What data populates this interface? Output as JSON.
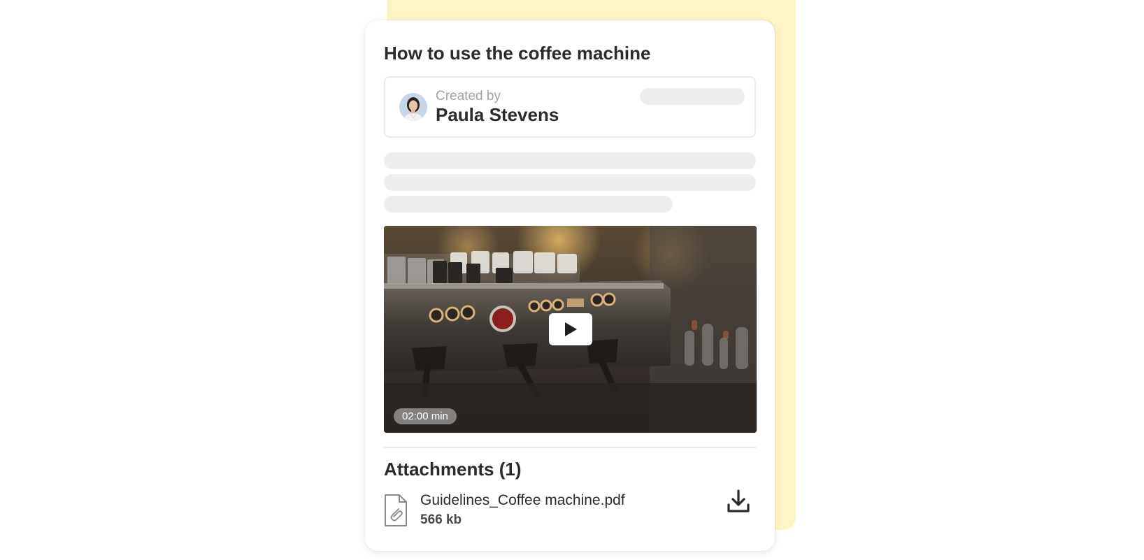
{
  "card": {
    "title": "How to use the coffee machine"
  },
  "author": {
    "created_by_label": "Created by",
    "name": "Paula Stevens",
    "avatar_icon": "user-avatar"
  },
  "video": {
    "duration": "02:00 min",
    "play_icon": "play-icon"
  },
  "attachments": {
    "title": "Attachments (1)",
    "files": [
      {
        "name": "Guidelines_Coffee machine.pdf",
        "size": "566 kb",
        "icon": "file-attachment-icon",
        "action_icon": "download-icon"
      }
    ]
  },
  "colors": {
    "accent_back_card": "#fdf5c6",
    "skeleton": "#eeeeee",
    "text_primary": "#2b2b2b",
    "text_muted": "#a3a3a3"
  }
}
